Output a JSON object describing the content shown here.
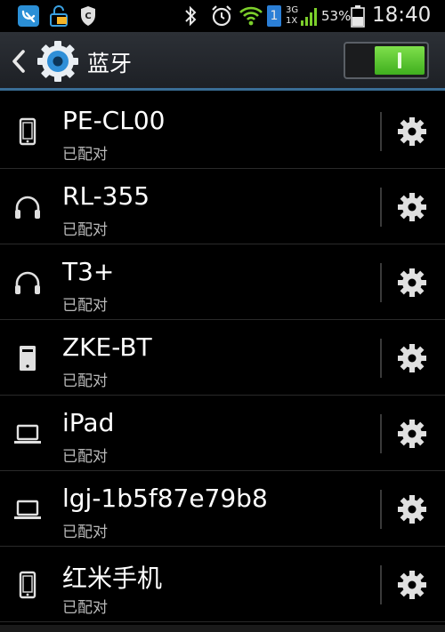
{
  "status_bar": {
    "network_label_top": "3G",
    "network_label_bottom": "1X",
    "battery": "53%",
    "time": "18:40",
    "sim_number": "1",
    "icons": [
      "app-icon",
      "lock-notification-icon",
      "shield-icon",
      "bluetooth-icon",
      "alarm-icon",
      "wifi-icon",
      "sim-icon",
      "signal-icon",
      "battery-icon"
    ]
  },
  "header": {
    "title": "蓝牙",
    "toggle_on": true,
    "accent_color": "#3a6d95"
  },
  "devices": [
    {
      "name": "PE-CL00",
      "status": "已配对",
      "icon": "phone-icon"
    },
    {
      "name": "RL-355",
      "status": "已配对",
      "icon": "headphones-icon"
    },
    {
      "name": "T3+",
      "status": "已配对",
      "icon": "headphones-icon"
    },
    {
      "name": "ZKE-BT",
      "status": "已配对",
      "icon": "device-icon"
    },
    {
      "name": "iPad",
      "status": "已配对",
      "icon": "laptop-icon"
    },
    {
      "name": "lgj-1b5f87e79b8",
      "status": "已配对",
      "icon": "laptop-icon"
    },
    {
      "name": "红米手机",
      "status": "已配对",
      "icon": "phone-icon"
    }
  ]
}
